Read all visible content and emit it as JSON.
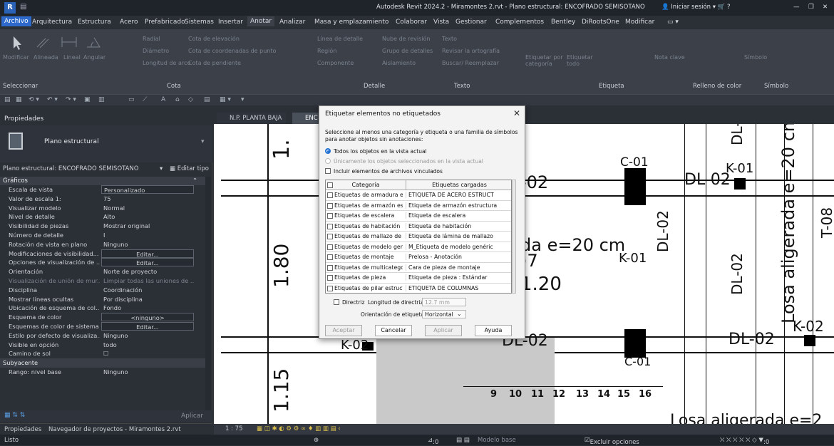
{
  "titlebar": {
    "logo": "R",
    "title": "Autodesk Revit 2024.2 - Miramontes 2.rvt - Plano estructural: ENCOFRADO SEMISOTANO",
    "signin": "Iniciar sesión",
    "help": "?"
  },
  "menu": [
    "Archivo",
    "Arquitectura",
    "Estructura",
    "Acero",
    "Prefabricado",
    "Sistemas",
    "Insertar",
    "Anotar",
    "Analizar",
    "Masa y emplazamiento",
    "Colaborar",
    "Vista",
    "Gestionar",
    "Complementos",
    "Bentley",
    "DiRootsOne",
    "Modificar"
  ],
  "ribbon": {
    "modificar": "Modificar",
    "alineada": "Alineada",
    "lineal": "Lineal",
    "angular": "Angular",
    "radial": "Radial",
    "diametro": "Diámetro",
    "longitud_arco": "Longitud de arco",
    "cota_elevacion": "Cota de elevación",
    "cota_coordenadas": "Cota de coordenadas de punto",
    "cota_pendiente": "Cota de pendiente",
    "linea_detalle": "Línea de detalle",
    "nube_revision": "Nube de revisión",
    "region": "Región",
    "grupo_detalles": "Grupo de detalles",
    "componente": "Componente",
    "aislamiento": "Aislamiento",
    "texto": "Texto",
    "revisar_ortografia": "Revisar la ortografía",
    "buscar_reemplazar": "Buscar/ Reemplazar",
    "etiquetar_categoria": "Etiquetar por categoría",
    "etiquetar_todo": "Etiquetar todo",
    "nota_clave": "Nota clave",
    "simbolo": "Símbolo",
    "groups": {
      "seleccionar": "Seleccionar",
      "cota": "Cota",
      "detalle": "Detalle",
      "texto": "Texto",
      "etiqueta": "Etiqueta",
      "relleno": "Relleno de color",
      "simbolo": "Símbolo"
    }
  },
  "properties": {
    "header": "Propiedades",
    "type_name": "Plano estructural",
    "selector": "Plano estructural: ENCOFRADO SEMISOTANO",
    "edit_type": "Editar tipo",
    "section_graficos": "Gráficos",
    "rows": [
      {
        "k": "Escala de vista",
        "v": "Personalizado",
        "box": true,
        "left": true
      },
      {
        "k": "Valor de escala    1:",
        "v": "75"
      },
      {
        "k": "Visualizar modelo",
        "v": "Normal"
      },
      {
        "k": "Nivel de detalle",
        "v": "Alto"
      },
      {
        "k": "Visibilidad de piezas",
        "v": "Mostrar original"
      },
      {
        "k": "Número de detalle",
        "v": "I"
      },
      {
        "k": "Rotación de vista en plano",
        "v": "Ninguno"
      },
      {
        "k": "Modificaciones de visibilidad...",
        "v": "Editar...",
        "box": true
      },
      {
        "k": "Opciones de visualización de ...",
        "v": "Editar...",
        "box": true
      },
      {
        "k": "Orientación",
        "v": "Norte de proyecto"
      },
      {
        "k": "Visualización de unión de mur...",
        "v": "Limpiar todas las uniones de ...",
        "dim": true
      },
      {
        "k": "Disciplina",
        "v": "Coordinación"
      },
      {
        "k": "Mostrar líneas ocultas",
        "v": "Por disciplina"
      },
      {
        "k": "Ubicación de esquema de col...",
        "v": "Fondo"
      },
      {
        "k": "Esquema de color",
        "v": "<ninguno>",
        "box": true
      },
      {
        "k": "Esquemas de color de sistema",
        "v": "Editar...",
        "box": true
      },
      {
        "k": "Estilo por defecto de visualiza...",
        "v": "Ninguno"
      },
      {
        "k": "Visible en opción",
        "v": "todo"
      },
      {
        "k": "Camino de sol",
        "v": "☐"
      }
    ],
    "section_subyacente": "Subyacente",
    "row_rango": {
      "k": "Rango: nivel base",
      "v": "Ninguno"
    },
    "apply": "Aplicar",
    "tabs": [
      "Propiedades",
      "Navegador de proyectos - Miramontes 2.rvt"
    ]
  },
  "view_tabs": [
    "N.P. PLANTA BAJA",
    "ENC"
  ],
  "drawing": {
    "dims": [
      "1.",
      "1.80",
      "1.15",
      "1.20"
    ],
    "labels": [
      "C-01",
      "K-01",
      "DL-02",
      "-02",
      "DL-02",
      "K-01",
      "DL-02",
      "DL-02",
      "DL-02",
      "K-02",
      "DL-02",
      "C-01",
      "K-02",
      "T-08"
    ],
    "slab": "Losa aligerada e=20 cm",
    "slab2": "Losa aligerada e=2",
    "da": "da e=20 cm",
    "seven": ")7",
    "nums": [
      "9",
      "10",
      "11",
      "12",
      "13",
      "14",
      "15",
      "16"
    ]
  },
  "dialog": {
    "title": "Etiquetar elementos no etiquetados",
    "instruction": "Seleccione al menos una categoría y etiqueta o una familia de símbolos para anotar objetos sin anotaciones:",
    "radio_all": "Todos los objetos en la vista actual",
    "radio_selected": "Únicamente los objetos seleccionados en la vista actual",
    "include_linked": "Incluir elementos de archivos vinculados",
    "col_categoria": "Categoría",
    "col_etiquetas": "Etiquetas cargadas",
    "rows": [
      {
        "c": "Etiquetas de armadura estru",
        "t": "ETIQUETA DE ACERO ESTRUCT"
      },
      {
        "c": "Etiquetas de armazón estru",
        "t": "Etiqueta de armazón estructura"
      },
      {
        "c": "Etiquetas de escalera",
        "t": "Etiqueta de escalera"
      },
      {
        "c": "Etiquetas de habitación",
        "t": "Etiqueta de habitación"
      },
      {
        "c": "Etiquetas de mallazo de ref",
        "t": "Etiqueta de lámina de mallazo"
      },
      {
        "c": "Etiquetas de modelo genéri",
        "t": "M_Etiqueta de modelo genéric"
      },
      {
        "c": "Etiquetas de montaje",
        "t": "Prelosa - Anotación"
      },
      {
        "c": "Etiquetas de multicategoría",
        "t": "Cara de pieza de montaje"
      },
      {
        "c": "Etiquetas de pieza",
        "t": "Etiqueta de pieza : Estándar"
      },
      {
        "c": "Etiquetas de pilar estructura",
        "t": "ETIQUETA DE COLUMNAS"
      }
    ],
    "directriz": "Directriz",
    "longitud_label": "Longitud de directriz:",
    "longitud_value": "12.7 mm",
    "orientacion_label": "Orientación de etiqueta:",
    "orientacion_value": "Horizontal",
    "aceptar": "Aceptar",
    "cancelar": "Cancelar",
    "aplicar": "Aplicar",
    "ayuda": "Ayuda"
  },
  "viewbar": {
    "scale": "1 : 75"
  },
  "status": {
    "left": "Listo",
    "zero": ":0",
    "modelo": "Modelo base",
    "excluir": "Excluir opciones",
    "filter": ":0"
  }
}
